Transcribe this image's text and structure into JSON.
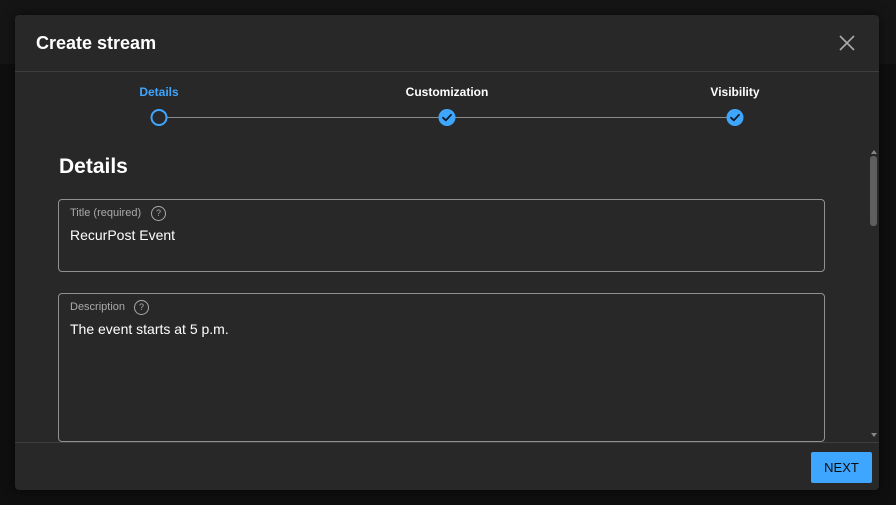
{
  "dialog": {
    "title": "Create stream"
  },
  "stepper": {
    "steps": [
      {
        "label": "Details",
        "state": "current"
      },
      {
        "label": "Customization",
        "state": "complete"
      },
      {
        "label": "Visibility",
        "state": "complete"
      }
    ]
  },
  "details": {
    "heading": "Details",
    "title_field": {
      "label": "Title (required)",
      "value": "RecurPost Event"
    },
    "description_field": {
      "label": "Description",
      "value": "The event starts at 5 p.m."
    }
  },
  "footer": {
    "next_label": "NEXT"
  },
  "colors": {
    "accent": "#3ea6ff",
    "dialog_bg": "#282828",
    "page_bg": "#0f0f0f"
  },
  "icons": {
    "close": "close-icon",
    "help": "help-icon",
    "check": "check-icon"
  }
}
